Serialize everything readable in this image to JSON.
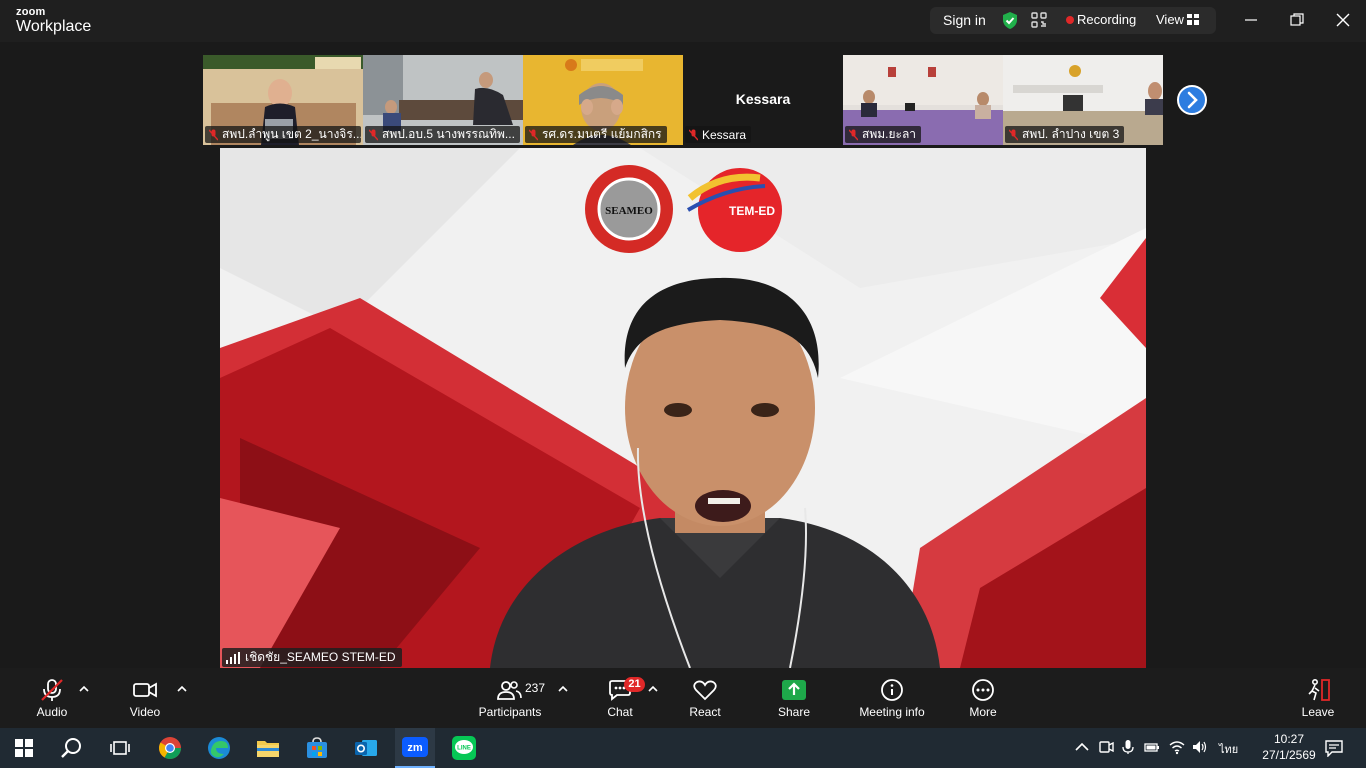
{
  "titlebar": {
    "brand_small": "zoom",
    "brand_large": "Workplace",
    "sign_in": "Sign in",
    "recording": "Recording",
    "view": "View",
    "icons": [
      "shield-check-icon",
      "qr-code-icon",
      "grid-icon",
      "minimize-icon",
      "restore-icon",
      "close-icon"
    ],
    "colors": {
      "shield": "#21b04b",
      "record": "#e02828"
    }
  },
  "thumbnails": [
    {
      "label": "สพป.ลำพูน เขต 2_นางจิร...",
      "muted": true
    },
    {
      "label": "สพป.อบ.5 นางพรรณทิพ...",
      "muted": true
    },
    {
      "label": "รศ.ดร.มนตรี แย้มกสิกร",
      "muted": true
    },
    {
      "label": "Kessara",
      "display_name": "Kessara",
      "muted": true
    },
    {
      "label": "สพม.ยะลา",
      "muted": true
    },
    {
      "label": "สพป. ลำปาง เขต 3",
      "muted": true
    }
  ],
  "main_video": {
    "speaker_name": "เชิดชัย_SEAMEO STEM-ED",
    "logo_left": "SEAMEO",
    "logo_right": "TEM-ED"
  },
  "toolbar": {
    "audio": "Audio",
    "video": "Video",
    "participants": "Participants",
    "participants_count": "237",
    "chat": "Chat",
    "chat_badge": "21",
    "react": "React",
    "share": "Share",
    "meeting_info": "Meeting info",
    "more": "More",
    "leave": "Leave",
    "colors": {
      "share": "#1ea84a",
      "leave": "#e02828",
      "badge": "#e02828"
    }
  },
  "taskbar": {
    "apps": [
      "windows-start-icon",
      "search-icon",
      "task-view-icon",
      "chrome-icon",
      "edge-icon",
      "file-explorer-icon",
      "store-icon",
      "outlook-icon",
      "zoom-icon",
      "line-icon"
    ],
    "active_app": "zoom",
    "zoom_label": "zm",
    "line_label": "LINE",
    "language": "ไทย",
    "time": "10:27",
    "date": "27/1/2569"
  }
}
